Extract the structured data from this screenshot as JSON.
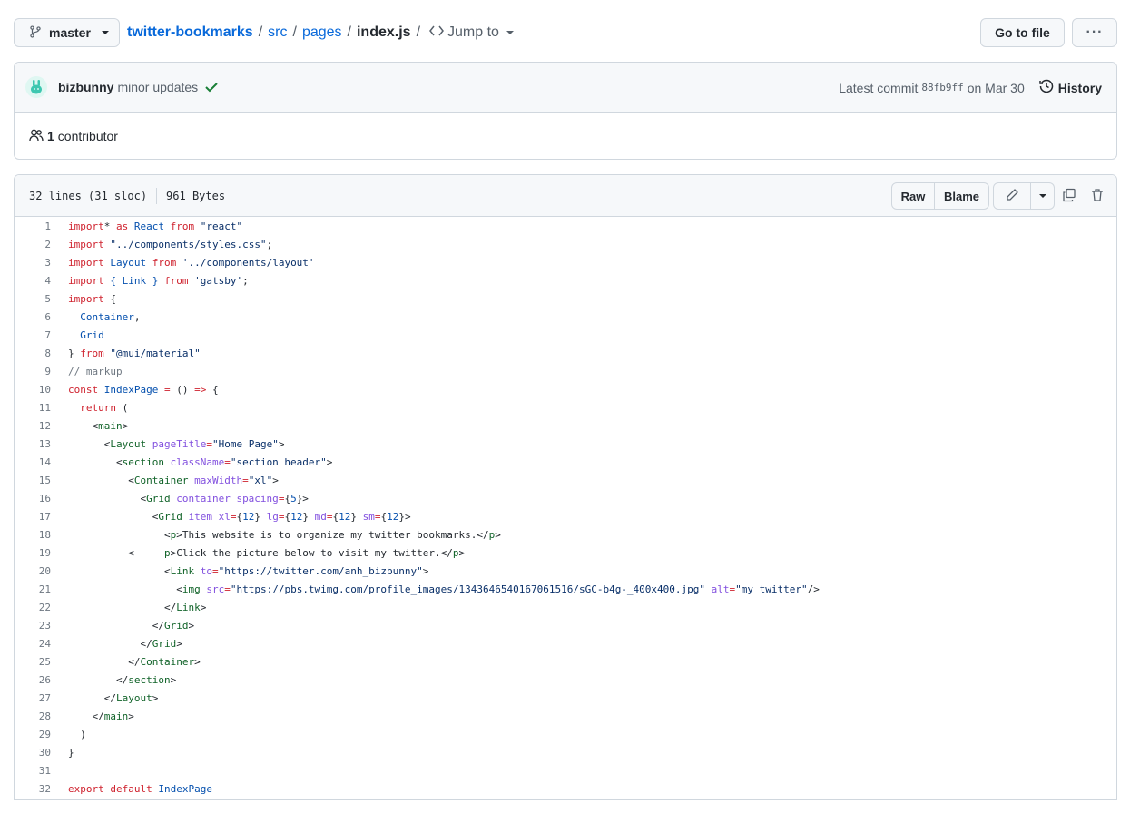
{
  "branch": {
    "name": "master"
  },
  "breadcrumb": {
    "repo": "twitter-bookmarks",
    "dirs": [
      "src",
      "pages"
    ],
    "file": "index.js",
    "separator": "/",
    "jump_label": "Jump to"
  },
  "actions": {
    "goto_file": "Go to file",
    "more": "···"
  },
  "commit": {
    "author": "bizbunny",
    "message": "minor updates",
    "latest_label": "Latest commit",
    "sha": "88fb9ff",
    "date": "on Mar 30",
    "history": "History"
  },
  "contributors": {
    "count": "1",
    "label": "contributor"
  },
  "file_info": {
    "lines": "32 lines (31 sloc)",
    "size": "961 Bytes"
  },
  "file_actions": {
    "raw": "Raw",
    "blame": "Blame"
  },
  "code_lines": [
    [
      [
        "k",
        "import"
      ],
      [
        "",
        "* "
      ],
      [
        "k",
        "as"
      ],
      [
        "a",
        " React "
      ],
      [
        "k",
        "from"
      ],
      [
        "s",
        " \"react\""
      ]
    ],
    [
      [
        "k",
        "import"
      ],
      [
        "s",
        " \"../components/styles.css\""
      ],
      [
        "",
        ";"
      ]
    ],
    [
      [
        "k",
        "import"
      ],
      [
        "a",
        " Layout "
      ],
      [
        "k",
        "from"
      ],
      [
        "s",
        " '../components/layout'"
      ]
    ],
    [
      [
        "k",
        "import"
      ],
      [
        "",
        ""
      ],
      [
        "a",
        " { Link } "
      ],
      [
        "k",
        "from"
      ],
      [
        "s",
        " 'gatsby'"
      ],
      [
        "",
        ";"
      ]
    ],
    [
      [
        "k",
        "import"
      ],
      [
        "",
        " {"
      ]
    ],
    [
      [
        "a",
        "  Container"
      ],
      [
        "",
        ","
      ]
    ],
    [
      [
        "a",
        "  Grid"
      ]
    ],
    [
      [
        "",
        "} "
      ],
      [
        "k",
        "from"
      ],
      [
        "s",
        " \"@mui/material\""
      ]
    ],
    [
      [
        "c",
        "// markup"
      ]
    ],
    [
      [
        "k",
        "const"
      ],
      [
        "a",
        " IndexPage "
      ],
      [
        "k",
        "="
      ],
      [
        "",
        " () "
      ],
      [
        "k",
        "=>"
      ],
      [
        "",
        " {"
      ]
    ],
    [
      [
        "k",
        "  return"
      ],
      [
        "",
        " ("
      ]
    ],
    [
      [
        "",
        "    <"
      ],
      [
        "t",
        "main"
      ],
      [
        "",
        ">"
      ]
    ],
    [
      [
        "",
        "      <"
      ],
      [
        "t",
        "Layout"
      ],
      [
        "e",
        " pageTitle"
      ],
      [
        "k",
        "="
      ],
      [
        "s",
        "\"Home Page\""
      ],
      [
        "",
        ">"
      ]
    ],
    [
      [
        "",
        "        <"
      ],
      [
        "t",
        "section"
      ],
      [
        "e",
        " className"
      ],
      [
        "k",
        "="
      ],
      [
        "s",
        "\"section header\""
      ],
      [
        "",
        ">"
      ]
    ],
    [
      [
        "",
        "          <"
      ],
      [
        "t",
        "Container"
      ],
      [
        "e",
        " maxWidth"
      ],
      [
        "k",
        "="
      ],
      [
        "s",
        "\"xl\""
      ],
      [
        "",
        ">"
      ]
    ],
    [
      [
        "",
        "            <"
      ],
      [
        "t",
        "Grid"
      ],
      [
        "e",
        " container spacing"
      ],
      [
        "k",
        "="
      ],
      [
        "",
        "{"
      ],
      [
        "a",
        "5"
      ],
      [
        "",
        "}>"
      ]
    ],
    [
      [
        "",
        "              <"
      ],
      [
        "t",
        "Grid"
      ],
      [
        "e",
        " item xl"
      ],
      [
        "k",
        "="
      ],
      [
        "",
        "{"
      ],
      [
        "a",
        "12"
      ],
      [
        "",
        "}"
      ],
      [
        "e",
        " lg"
      ],
      [
        "k",
        "="
      ],
      [
        "",
        "{"
      ],
      [
        "a",
        "12"
      ],
      [
        "",
        "}"
      ],
      [
        "e",
        " md"
      ],
      [
        "k",
        "="
      ],
      [
        "",
        "{"
      ],
      [
        "a",
        "12"
      ],
      [
        "",
        "}"
      ],
      [
        "e",
        " sm"
      ],
      [
        "k",
        "="
      ],
      [
        "",
        "{"
      ],
      [
        "a",
        "12"
      ],
      [
        "",
        "}>"
      ]
    ],
    [
      [
        "",
        "                <"
      ],
      [
        "t",
        "p"
      ],
      [
        "",
        ">This website is to organize my twitter bookmarks.</"
      ],
      [
        "t",
        "p"
      ],
      [
        "",
        ">"
      ]
    ],
    [
      [
        "",
        "          <     "
      ],
      [
        "t",
        "p"
      ],
      [
        "",
        ">Click the picture below to visit my twitter.</"
      ],
      [
        "t",
        "p"
      ],
      [
        "",
        ">"
      ]
    ],
    [
      [
        "",
        "                <"
      ],
      [
        "t",
        "Link"
      ],
      [
        "e",
        " to"
      ],
      [
        "k",
        "="
      ],
      [
        "s",
        "\"https://twitter.com/anh_bizbunny\""
      ],
      [
        "",
        ">"
      ]
    ],
    [
      [
        "",
        "                  <"
      ],
      [
        "t",
        "img"
      ],
      [
        "e",
        " src"
      ],
      [
        "k",
        "="
      ],
      [
        "s",
        "\"https://pbs.twimg.com/profile_images/1343646540167061516/sGC-b4g-_400x400.jpg\""
      ],
      [
        "e",
        " alt"
      ],
      [
        "k",
        "="
      ],
      [
        "s",
        "\"my twitter\""
      ],
      [
        "",
        "/>"
      ]
    ],
    [
      [
        "",
        "                </"
      ],
      [
        "t",
        "Link"
      ],
      [
        "",
        ">"
      ]
    ],
    [
      [
        "",
        "              </"
      ],
      [
        "t",
        "Grid"
      ],
      [
        "",
        ">"
      ]
    ],
    [
      [
        "",
        "            </"
      ],
      [
        "t",
        "Grid"
      ],
      [
        "",
        ">"
      ]
    ],
    [
      [
        "",
        "          </"
      ],
      [
        "t",
        "Container"
      ],
      [
        "",
        ">"
      ]
    ],
    [
      [
        "",
        "        </"
      ],
      [
        "t",
        "section"
      ],
      [
        "",
        ">"
      ]
    ],
    [
      [
        "",
        "      </"
      ],
      [
        "t",
        "Layout"
      ],
      [
        "",
        ">"
      ]
    ],
    [
      [
        "",
        "    </"
      ],
      [
        "t",
        "main"
      ],
      [
        "",
        ">"
      ]
    ],
    [
      [
        "",
        "  )"
      ]
    ],
    [
      [
        "",
        "}"
      ]
    ],
    [
      [
        "",
        ""
      ]
    ],
    [
      [
        "k",
        "export"
      ],
      [
        "k",
        " default"
      ],
      [
        "a",
        " IndexPage"
      ]
    ]
  ]
}
